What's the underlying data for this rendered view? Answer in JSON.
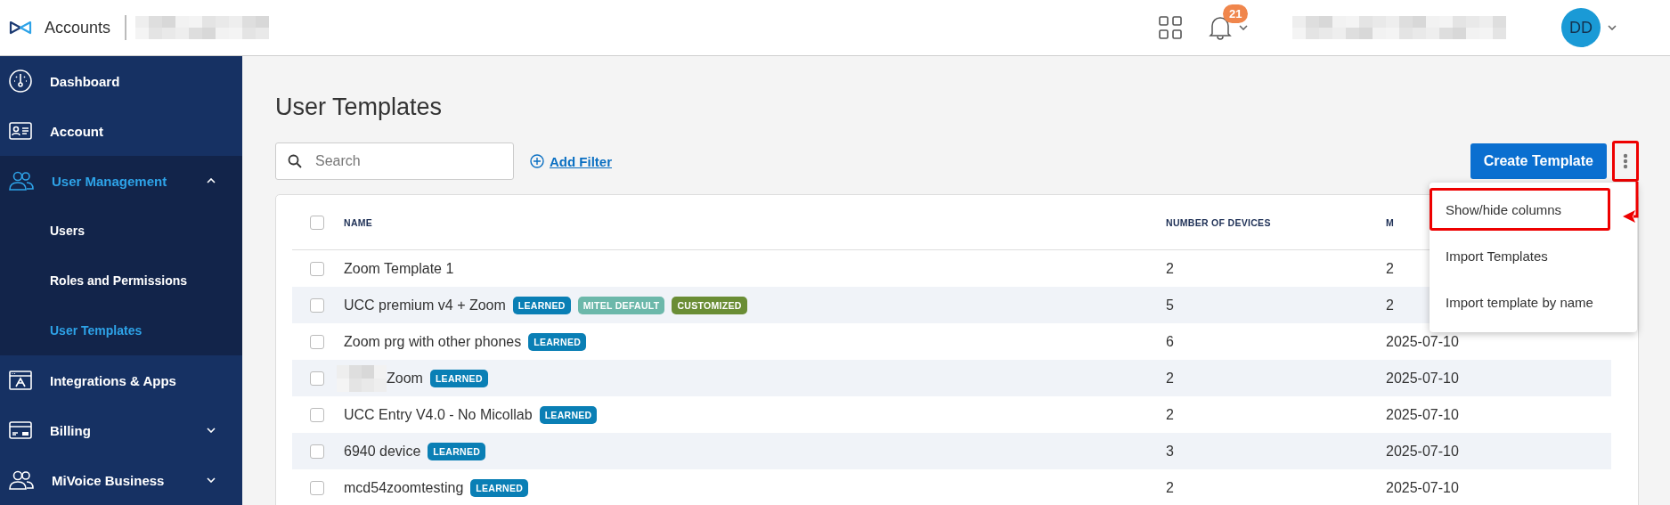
{
  "header": {
    "app_name": "Accounts",
    "notification_count": "21",
    "avatar_initials": "DD"
  },
  "sidebar": {
    "items": [
      {
        "label": "Dashboard",
        "kind": "dashboard",
        "selected": false
      },
      {
        "label": "Account",
        "kind": "account",
        "selected": false
      },
      {
        "label": "User Management",
        "kind": "users",
        "selected": true,
        "expanded": true,
        "children": [
          {
            "label": "Users",
            "selected": false
          },
          {
            "label": "Roles and Permissions",
            "selected": false
          },
          {
            "label": "User Templates",
            "selected": true
          }
        ]
      },
      {
        "label": "Integrations & Apps",
        "kind": "apps",
        "selected": false
      },
      {
        "label": "Billing",
        "kind": "billing",
        "selected": false,
        "expanded": false
      },
      {
        "label": "MiVoice Business",
        "kind": "users",
        "selected": false,
        "expanded": false
      }
    ]
  },
  "page": {
    "title": "User Templates",
    "search": {
      "placeholder": "Search"
    },
    "add_filter": "Add Filter",
    "create_button": "Create Template",
    "more_button": {
      "highlighted": true
    }
  },
  "menu": {
    "items": [
      {
        "label": "Show/hide columns",
        "highlighted": true
      },
      {
        "label": "Import Templates",
        "highlighted": false
      },
      {
        "label": "Import template by name",
        "highlighted": false
      }
    ]
  },
  "table": {
    "select_all_checked": false,
    "columns": [
      "NAME",
      "NUMBER OF DEVICES",
      "M"
    ],
    "rows": [
      {
        "checked": false,
        "redacted_prefix": false,
        "name": "Zoom Template 1",
        "badges": [],
        "devices": "2",
        "column_3": "2"
      },
      {
        "checked": false,
        "redacted_prefix": false,
        "name": "UCC premium v4 + Zoom",
        "badges": [
          {
            "label": "LEARNED",
            "color": "#0a7fb5"
          },
          {
            "label": "MITEL DEFAULT",
            "color": "#6cb8aa"
          },
          {
            "label": "CUSTOMIZED",
            "color": "#6a8d35"
          }
        ],
        "devices": "5",
        "column_3": "2"
      },
      {
        "checked": false,
        "redacted_prefix": false,
        "name": "Zoom prg with other phones",
        "badges": [
          {
            "label": "LEARNED",
            "color": "#0a7fb5"
          }
        ],
        "devices": "6",
        "column_3": "2025-07-10"
      },
      {
        "checked": false,
        "redacted_prefix": true,
        "name": "Zoom",
        "badges": [
          {
            "label": "LEARNED",
            "color": "#0a7fb5"
          }
        ],
        "devices": "2",
        "column_3": "2025-07-10"
      },
      {
        "checked": false,
        "redacted_prefix": false,
        "name": "UCC Entry V4.0 - No Micollab",
        "badges": [
          {
            "label": "LEARNED",
            "color": "#0a7fb5"
          }
        ],
        "devices": "2",
        "column_3": "2025-07-10"
      },
      {
        "checked": false,
        "redacted_prefix": false,
        "name": "6940 device",
        "badges": [
          {
            "label": "LEARNED",
            "color": "#0a7fb5"
          }
        ],
        "devices": "3",
        "column_3": "2025-07-10"
      },
      {
        "checked": false,
        "redacted_prefix": false,
        "name": "mcd54zoomtesting",
        "badges": [
          {
            "label": "LEARNED",
            "color": "#0a7fb5"
          }
        ],
        "devices": "2",
        "column_3": "2025-07-10"
      }
    ]
  }
}
